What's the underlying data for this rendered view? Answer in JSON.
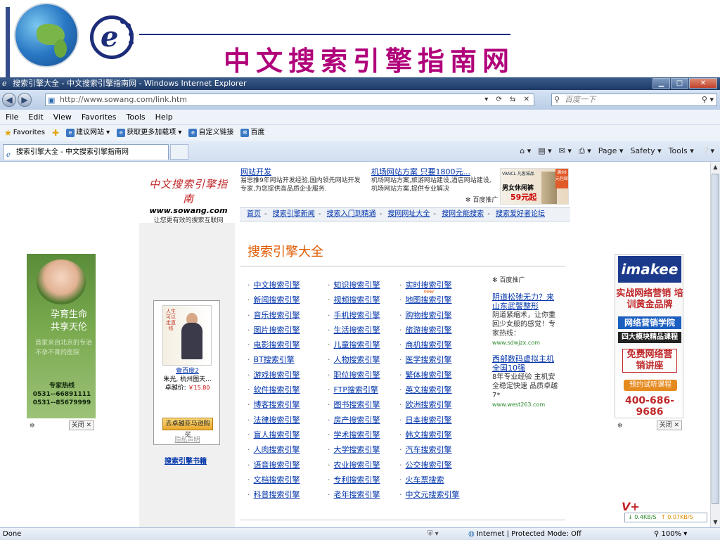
{
  "slide": {
    "title": "中文搜索引擎指南网"
  },
  "window": {
    "title": "搜索引擎大全 - 中文搜索引擎指南网 - Windows Internet Explorer",
    "minimize": "▁",
    "maximize": "□",
    "close": "✕"
  },
  "address": {
    "url": "http://www.sowang.com/link.htm",
    "search_placeholder": "百度一下"
  },
  "menu": [
    "File",
    "Edit",
    "View",
    "Favorites",
    "Tools",
    "Help"
  ],
  "favorites_bar": {
    "favorites_label": "Favorites",
    "items": [
      "建议网站 ▾",
      "获取更多加载项 ▾",
      "自定义链接",
      "百度"
    ]
  },
  "tab": {
    "label": "搜索引擎大全 - 中文搜索引擎指南网"
  },
  "command_bar": [
    "Page ▾",
    "Safety ▾",
    "Tools ▾"
  ],
  "site": {
    "logo_text": "中文搜索引擎指南",
    "logo_url": "www.sowang.com",
    "slogan": "让您更有效的搜索互联网"
  },
  "top_ads": [
    {
      "title": "网站开发",
      "body": "易思推9年网站开发经验,国内领先网站开发专家,为您提供高品质企业服务."
    },
    {
      "title": "机场网站方案 只要1800元...",
      "body": "机场网站方案,旅游网站建设,酒店网站建设,机场网站方案,提供专业解决"
    }
  ],
  "baidu_tag": "百度推广",
  "clothes_ad": {
    "brand": "VANCL 凡客诚品",
    "headline": "男女休闲裤",
    "price": "59元起",
    "ribbon": "满99元包邮"
  },
  "nav_links": [
    "首页",
    "搜索引擎新闻",
    "搜索入门到精通",
    "搜网网址大全",
    "搜网全能搜索",
    "搜索爱好者论坛"
  ],
  "page_heading": "搜索引擎大全",
  "link_columns": [
    [
      "中文搜索引擎",
      "新闻搜索引擎",
      "音乐搜索引擎",
      "图片搜索引擎",
      "电影搜索引擎",
      "BT搜索引擎",
      "游戏搜索引擎",
      "软件搜索引擎",
      "博客搜索引擎",
      "法律搜索引擎",
      "盲人搜索引擎",
      "人肉搜索引擎",
      "语音搜索引擎",
      "文档搜索引擎",
      "科普搜索引擎"
    ],
    [
      "知识搜索引擎",
      "视频搜索引擎",
      "手机搜索引擎",
      "生活搜索引擎",
      "儿童搜索引擎",
      "人物搜索引擎",
      "职位搜索引擎",
      "FTP搜索引擎",
      "图书搜索引擎",
      "房产搜索引擎",
      "学术搜索引擎",
      "大学搜索引擎",
      "农业搜索引擎",
      "专利搜索引擎",
      "老年搜索引擎"
    ],
    [
      "实时搜索引擎",
      "地图搜索引擎",
      "购物搜索引擎",
      "旅游搜索引擎",
      "商机搜索引擎",
      "医学搜索引擎",
      "繁体搜索引擎",
      "英文搜索引擎",
      "欧洲搜索引擎",
      "日本搜索引擎",
      "韩文搜索引擎",
      "汽车搜索引擎",
      "公交搜索引擎",
      "火车票搜索",
      "中文元搜索引擎"
    ]
  ],
  "new_tag": "new",
  "right_ads": [
    {
      "title": "阴道松弛无力？来山东武警整形",
      "body": "阴道紧缩术，让你重回少女般的感觉！专家热线：",
      "url": "www.sdwjzx.com"
    },
    {
      "title": "西部数码虚拟主机全国10强",
      "body": "8年专业经验 主机安全稳定快速 品质卓越 7*",
      "url": "www.west263.com"
    }
  ],
  "book": {
    "spine": "人生可以走直线",
    "link": "壹百度2",
    "author": "朱光, 杭州图天...",
    "price_label": "卓越价: ",
    "price": "￥15.80",
    "buy_button": "去卓越亚马逊购买",
    "privacy": "隐私声明"
  },
  "books_link": "搜索引擎书籍",
  "left_ad": {
    "slogan": "孕育生命 共享天伦",
    "addr": "首家来自北京的专治不孕不育的医院",
    "hotline_label": "专家热线",
    "phones": "0531--66891111 0531--85679999",
    "close": "关闭 ✕"
  },
  "right_ad": {
    "brand": "imakee",
    "l1": "实战网络营销 培训黄金品牌",
    "l2": "网络营销学院",
    "l3": "四大模块精品课程",
    "l4": "免费网络营销讲座",
    "l5": "预约试听课程",
    "phone": "400-686-9686",
    "close": "关闭 ✕"
  },
  "speed": {
    "down": "↓ 0.4KB/S",
    "up": "↑ 0.07KB/S"
  },
  "status": {
    "left": "Done",
    "zone": "Internet | Protected Mode: Off",
    "zoom": "100%"
  }
}
